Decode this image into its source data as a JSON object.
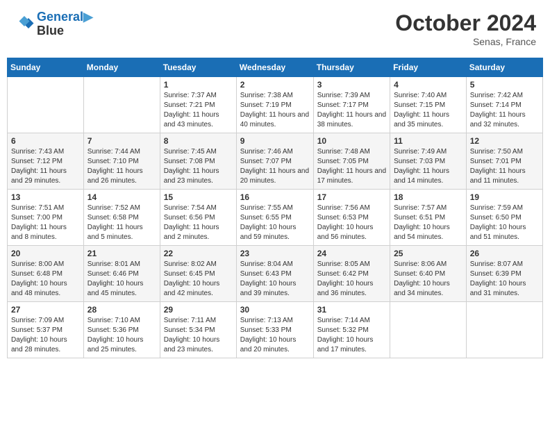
{
  "header": {
    "logo_line1": "General",
    "logo_line2": "Blue",
    "month": "October 2024",
    "location": "Senas, France"
  },
  "days_of_week": [
    "Sunday",
    "Monday",
    "Tuesday",
    "Wednesday",
    "Thursday",
    "Friday",
    "Saturday"
  ],
  "weeks": [
    [
      {
        "day": "",
        "info": ""
      },
      {
        "day": "",
        "info": ""
      },
      {
        "day": "1",
        "info": "Sunrise: 7:37 AM\nSunset: 7:21 PM\nDaylight: 11 hours and 43 minutes."
      },
      {
        "day": "2",
        "info": "Sunrise: 7:38 AM\nSunset: 7:19 PM\nDaylight: 11 hours and 40 minutes."
      },
      {
        "day": "3",
        "info": "Sunrise: 7:39 AM\nSunset: 7:17 PM\nDaylight: 11 hours and 38 minutes."
      },
      {
        "day": "4",
        "info": "Sunrise: 7:40 AM\nSunset: 7:15 PM\nDaylight: 11 hours and 35 minutes."
      },
      {
        "day": "5",
        "info": "Sunrise: 7:42 AM\nSunset: 7:14 PM\nDaylight: 11 hours and 32 minutes."
      }
    ],
    [
      {
        "day": "6",
        "info": "Sunrise: 7:43 AM\nSunset: 7:12 PM\nDaylight: 11 hours and 29 minutes."
      },
      {
        "day": "7",
        "info": "Sunrise: 7:44 AM\nSunset: 7:10 PM\nDaylight: 11 hours and 26 minutes."
      },
      {
        "day": "8",
        "info": "Sunrise: 7:45 AM\nSunset: 7:08 PM\nDaylight: 11 hours and 23 minutes."
      },
      {
        "day": "9",
        "info": "Sunrise: 7:46 AM\nSunset: 7:07 PM\nDaylight: 11 hours and 20 minutes."
      },
      {
        "day": "10",
        "info": "Sunrise: 7:48 AM\nSunset: 7:05 PM\nDaylight: 11 hours and 17 minutes."
      },
      {
        "day": "11",
        "info": "Sunrise: 7:49 AM\nSunset: 7:03 PM\nDaylight: 11 hours and 14 minutes."
      },
      {
        "day": "12",
        "info": "Sunrise: 7:50 AM\nSunset: 7:01 PM\nDaylight: 11 hours and 11 minutes."
      }
    ],
    [
      {
        "day": "13",
        "info": "Sunrise: 7:51 AM\nSunset: 7:00 PM\nDaylight: 11 hours and 8 minutes."
      },
      {
        "day": "14",
        "info": "Sunrise: 7:52 AM\nSunset: 6:58 PM\nDaylight: 11 hours and 5 minutes."
      },
      {
        "day": "15",
        "info": "Sunrise: 7:54 AM\nSunset: 6:56 PM\nDaylight: 11 hours and 2 minutes."
      },
      {
        "day": "16",
        "info": "Sunrise: 7:55 AM\nSunset: 6:55 PM\nDaylight: 10 hours and 59 minutes."
      },
      {
        "day": "17",
        "info": "Sunrise: 7:56 AM\nSunset: 6:53 PM\nDaylight: 10 hours and 56 minutes."
      },
      {
        "day": "18",
        "info": "Sunrise: 7:57 AM\nSunset: 6:51 PM\nDaylight: 10 hours and 54 minutes."
      },
      {
        "day": "19",
        "info": "Sunrise: 7:59 AM\nSunset: 6:50 PM\nDaylight: 10 hours and 51 minutes."
      }
    ],
    [
      {
        "day": "20",
        "info": "Sunrise: 8:00 AM\nSunset: 6:48 PM\nDaylight: 10 hours and 48 minutes."
      },
      {
        "day": "21",
        "info": "Sunrise: 8:01 AM\nSunset: 6:46 PM\nDaylight: 10 hours and 45 minutes."
      },
      {
        "day": "22",
        "info": "Sunrise: 8:02 AM\nSunset: 6:45 PM\nDaylight: 10 hours and 42 minutes."
      },
      {
        "day": "23",
        "info": "Sunrise: 8:04 AM\nSunset: 6:43 PM\nDaylight: 10 hours and 39 minutes."
      },
      {
        "day": "24",
        "info": "Sunrise: 8:05 AM\nSunset: 6:42 PM\nDaylight: 10 hours and 36 minutes."
      },
      {
        "day": "25",
        "info": "Sunrise: 8:06 AM\nSunset: 6:40 PM\nDaylight: 10 hours and 34 minutes."
      },
      {
        "day": "26",
        "info": "Sunrise: 8:07 AM\nSunset: 6:39 PM\nDaylight: 10 hours and 31 minutes."
      }
    ],
    [
      {
        "day": "27",
        "info": "Sunrise: 7:09 AM\nSunset: 5:37 PM\nDaylight: 10 hours and 28 minutes."
      },
      {
        "day": "28",
        "info": "Sunrise: 7:10 AM\nSunset: 5:36 PM\nDaylight: 10 hours and 25 minutes."
      },
      {
        "day": "29",
        "info": "Sunrise: 7:11 AM\nSunset: 5:34 PM\nDaylight: 10 hours and 23 minutes."
      },
      {
        "day": "30",
        "info": "Sunrise: 7:13 AM\nSunset: 5:33 PM\nDaylight: 10 hours and 20 minutes."
      },
      {
        "day": "31",
        "info": "Sunrise: 7:14 AM\nSunset: 5:32 PM\nDaylight: 10 hours and 17 minutes."
      },
      {
        "day": "",
        "info": ""
      },
      {
        "day": "",
        "info": ""
      }
    ]
  ]
}
